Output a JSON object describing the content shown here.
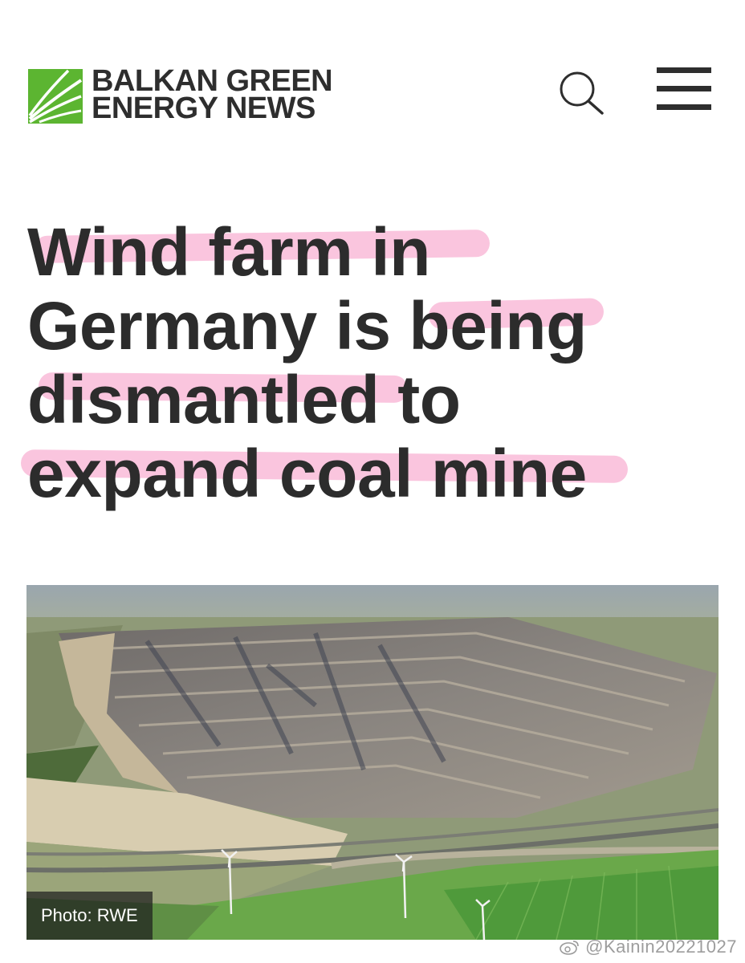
{
  "header": {
    "brand_line1": "BALKAN GREEN",
    "brand_line2": "ENERGY NEWS",
    "logo_icon": "bgen-logo",
    "search_icon": "search-icon",
    "menu_icon": "hamburger-menu-icon"
  },
  "article": {
    "headline_lines": [
      "Wind farm in",
      "Germany is being",
      "dismantled to",
      "expand coal mine"
    ],
    "highlight_color": "#f596c3"
  },
  "photo": {
    "alt": "Aerial view of open-pit coal mine with wind turbines",
    "credit": "Photo: RWE"
  },
  "watermark": {
    "text": "@Kainin20221027",
    "icon": "weibo-icon"
  },
  "colors": {
    "brand_green": "#5cb531",
    "text_dark": "#2c2c2c"
  }
}
